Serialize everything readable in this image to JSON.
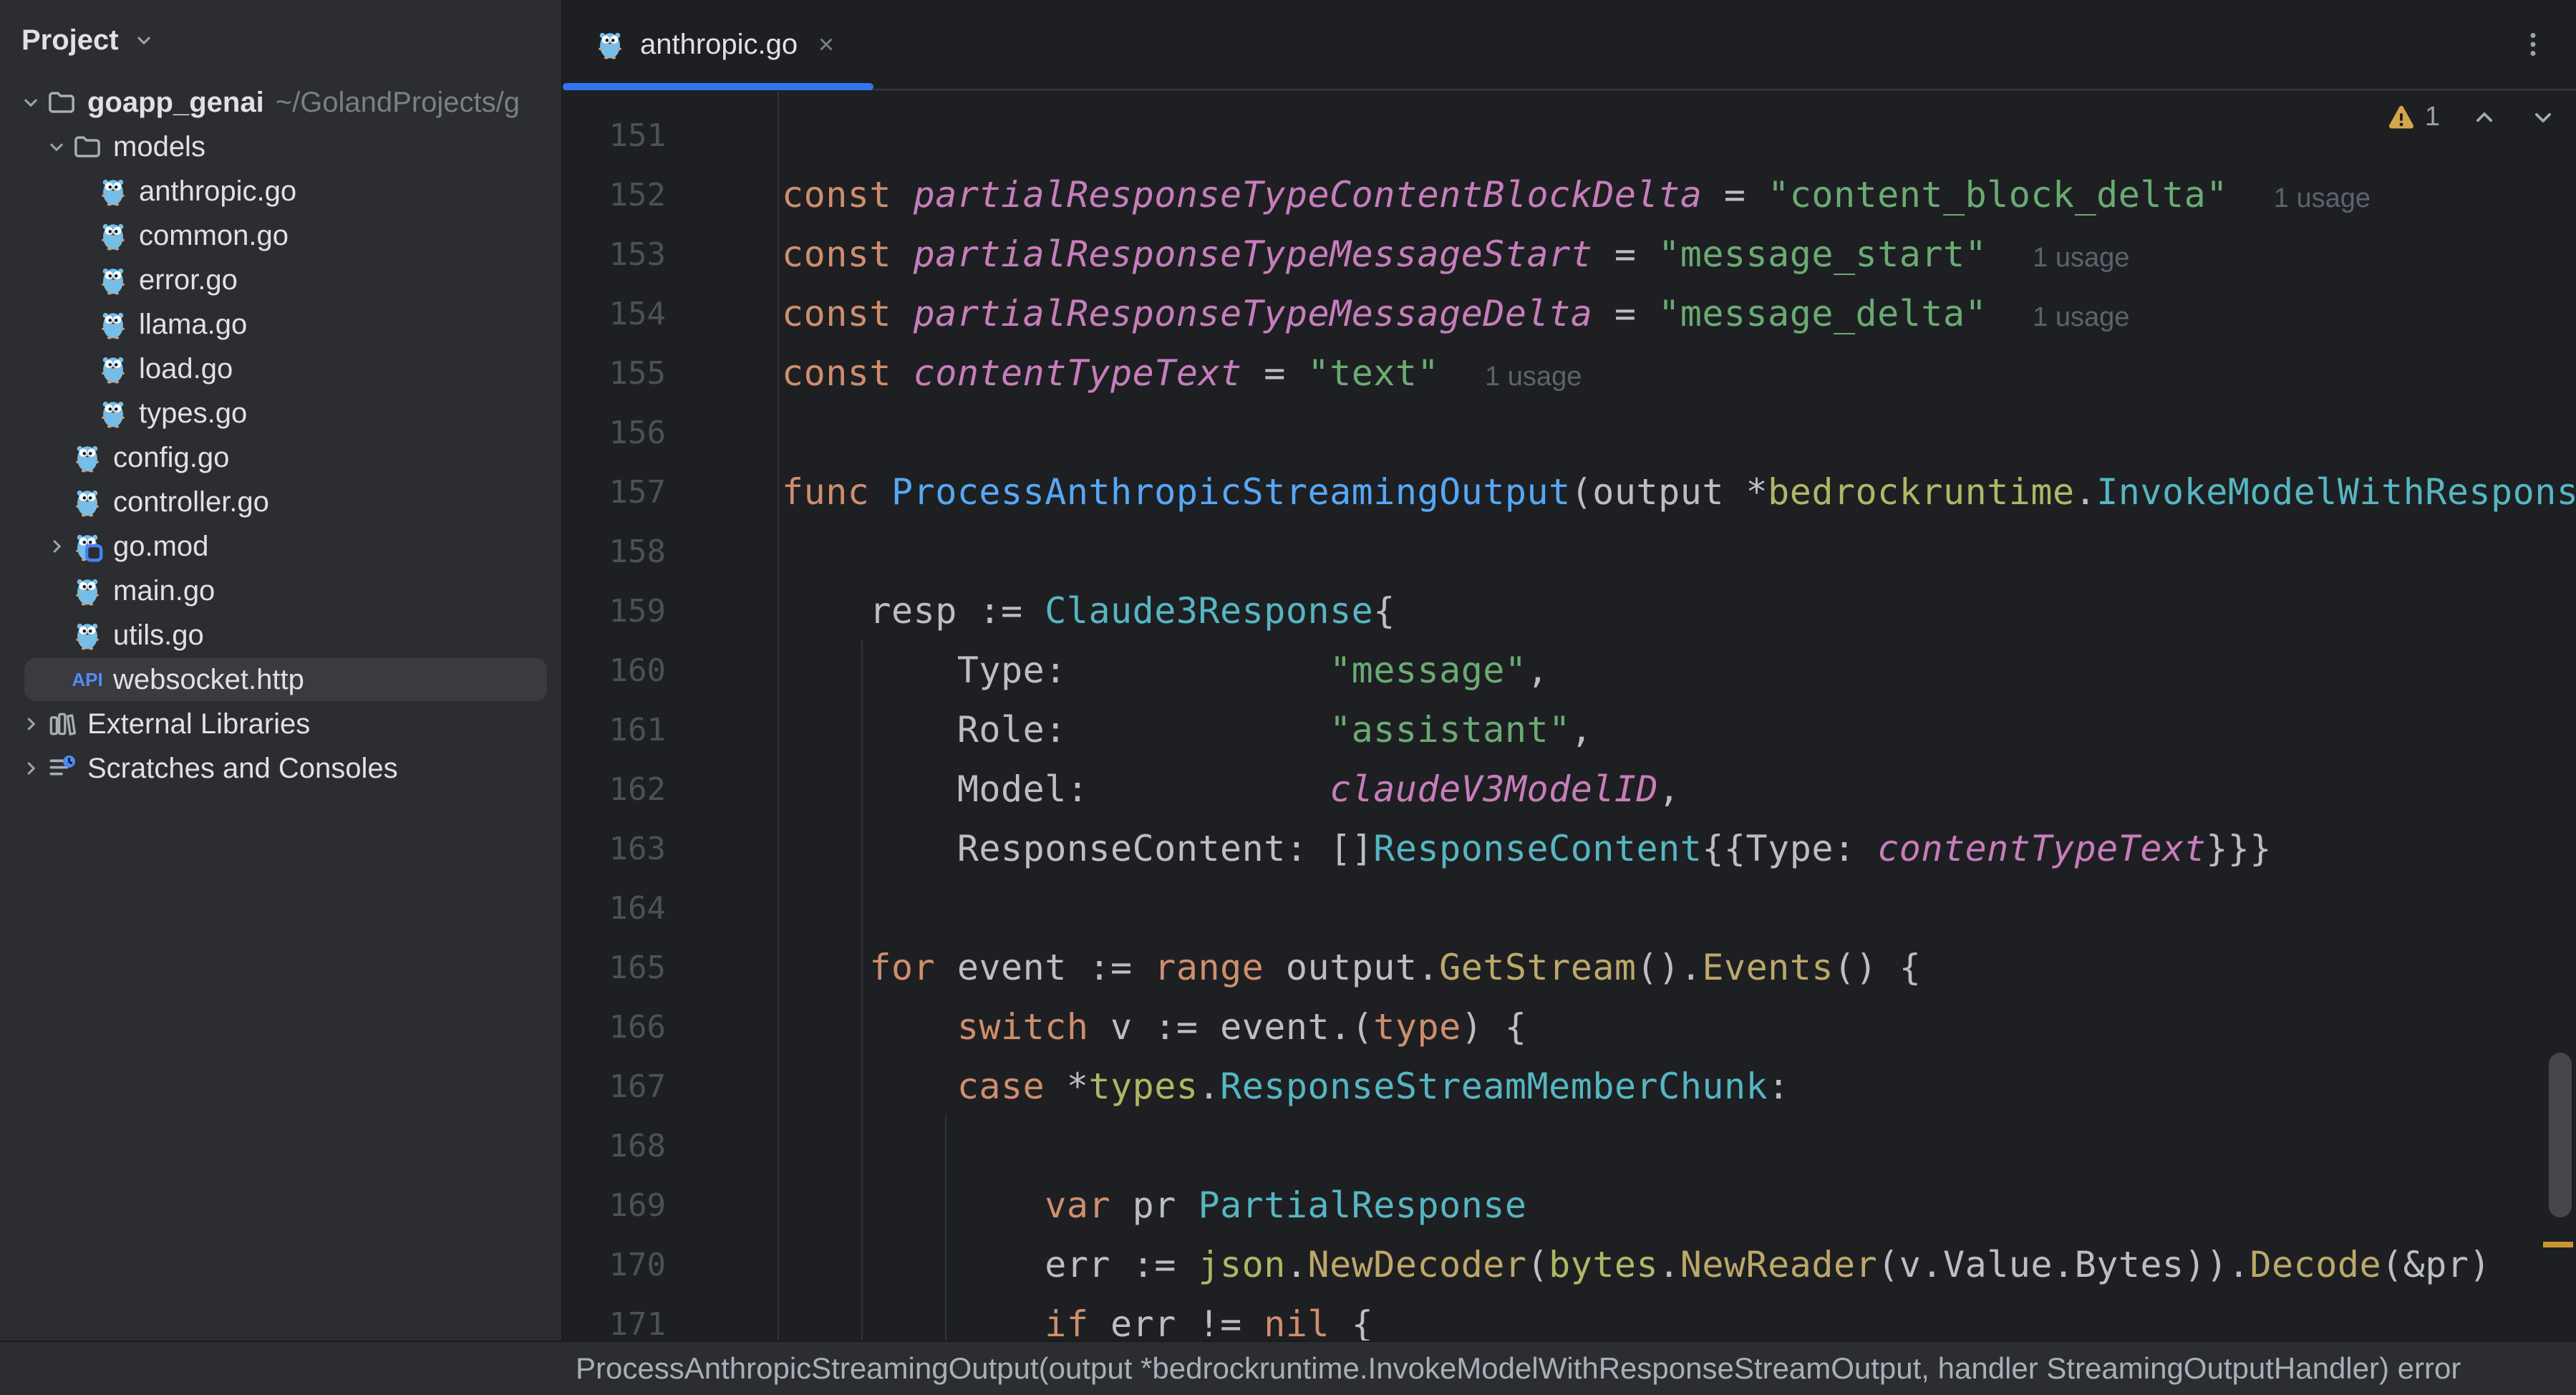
{
  "colors": {
    "accent": "#3574F0",
    "warning": "#D2A64A",
    "sidebar-bg": "#2B2D30",
    "editor-bg": "#1E1F22",
    "selection-bg": "#393B40",
    "syn-kw": "#CF8E6D",
    "syn-const": "#C77DBB",
    "syn-str": "#6AAB73",
    "syn-fn": "#56A8F5",
    "syn-type": "#56B6C2",
    "syn-pkg": "#B1B665",
    "syn-call": "#BDA869",
    "syn-txt": "#BCBEC4",
    "line-num": "#4B5059",
    "inlay": "#5D636D",
    "scroll-warn": "#C8962E"
  },
  "sidebar": {
    "header": {
      "title": "Project",
      "chevron_icon": "chevron-down"
    },
    "tree": [
      {
        "label": "goapp_genai",
        "path": "~/GolandProjects/g",
        "icon": "folder",
        "chevron": "down",
        "indent": 0,
        "bold": true
      },
      {
        "label": "models",
        "icon": "folder",
        "chevron": "down",
        "indent": 1
      },
      {
        "label": "anthropic.go",
        "icon": "go-gopher",
        "indent": 2
      },
      {
        "label": "common.go",
        "icon": "go-gopher",
        "indent": 2
      },
      {
        "label": "error.go",
        "icon": "go-gopher",
        "indent": 2
      },
      {
        "label": "llama.go",
        "icon": "go-gopher",
        "indent": 2
      },
      {
        "label": "load.go",
        "icon": "go-gopher",
        "indent": 2
      },
      {
        "label": "types.go",
        "icon": "go-gopher",
        "indent": 2
      },
      {
        "label": "config.go",
        "icon": "go-gopher",
        "indent": 1
      },
      {
        "label": "controller.go",
        "icon": "go-gopher",
        "indent": 1
      },
      {
        "label": "go.mod",
        "icon": "go-mod",
        "chevron": "right",
        "indent": 1
      },
      {
        "label": "main.go",
        "icon": "go-gopher",
        "indent": 1
      },
      {
        "label": "utils.go",
        "icon": "go-gopher",
        "indent": 1
      },
      {
        "label": "websocket.http",
        "icon": "api",
        "indent": 1,
        "selected": true
      },
      {
        "label": "External Libraries",
        "icon": "libraries",
        "chevron": "right",
        "indent": 0
      },
      {
        "label": "Scratches and Consoles",
        "icon": "scratches",
        "chevron": "right",
        "indent": 0
      }
    ]
  },
  "tabbar": {
    "tabs": [
      {
        "label": "anthropic.go",
        "icon": "go-gopher",
        "active": true
      }
    ],
    "kebab_icon": "kebab-menu"
  },
  "editor": {
    "inspection": {
      "warnings": "1"
    },
    "lines": [
      {
        "num": "151",
        "tokens": []
      },
      {
        "num": "152",
        "tokens": [
          {
            "t": "const ",
            "c": "kw"
          },
          {
            "t": "partialResponseTypeContentBlockDelta",
            "c": "const"
          },
          {
            "t": " = ",
            "c": "txt"
          },
          {
            "t": "\"content_block_delta\"",
            "c": "str"
          }
        ],
        "usage": "1 usage"
      },
      {
        "num": "153",
        "tokens": [
          {
            "t": "const ",
            "c": "kw"
          },
          {
            "t": "partialResponseTypeMessageStart",
            "c": "const"
          },
          {
            "t": " = ",
            "c": "txt"
          },
          {
            "t": "\"message_start\"",
            "c": "str"
          }
        ],
        "usage": "1 usage"
      },
      {
        "num": "154",
        "tokens": [
          {
            "t": "const ",
            "c": "kw"
          },
          {
            "t": "partialResponseTypeMessageDelta",
            "c": "const"
          },
          {
            "t": " = ",
            "c": "txt"
          },
          {
            "t": "\"message_delta\"",
            "c": "str"
          }
        ],
        "usage": "1 usage"
      },
      {
        "num": "155",
        "tokens": [
          {
            "t": "const ",
            "c": "kw"
          },
          {
            "t": "contentTypeText",
            "c": "const"
          },
          {
            "t": " = ",
            "c": "txt"
          },
          {
            "t": "\"text\"",
            "c": "str"
          }
        ],
        "usage": "1 usage"
      },
      {
        "num": "156",
        "tokens": []
      },
      {
        "num": "157",
        "tokens": [
          {
            "t": "func ",
            "c": "kw"
          },
          {
            "t": "ProcessAnthropicStreamingOutput",
            "c": "fn"
          },
          {
            "t": "(output *",
            "c": "txt"
          },
          {
            "t": "bedrockruntime",
            "c": "pkg"
          },
          {
            "t": ".",
            "c": "txt"
          },
          {
            "t": "InvokeModelWithResponse",
            "c": "type"
          }
        ]
      },
      {
        "num": "158",
        "tokens": []
      },
      {
        "num": "159",
        "tokens": [
          {
            "t": "    resp := ",
            "c": "txt"
          },
          {
            "t": "Claude3Response",
            "c": "type"
          },
          {
            "t": "{",
            "c": "txt"
          }
        ]
      },
      {
        "num": "160",
        "tokens": [
          {
            "t": "        Type:            ",
            "c": "txt"
          },
          {
            "t": "\"message\"",
            "c": "str"
          },
          {
            "t": ",",
            "c": "txt"
          }
        ]
      },
      {
        "num": "161",
        "tokens": [
          {
            "t": "        Role:            ",
            "c": "txt"
          },
          {
            "t": "\"assistant\"",
            "c": "str"
          },
          {
            "t": ",",
            "c": "txt"
          }
        ]
      },
      {
        "num": "162",
        "tokens": [
          {
            "t": "        Model:           ",
            "c": "txt"
          },
          {
            "t": "claudeV3ModelID",
            "c": "const"
          },
          {
            "t": ",",
            "c": "txt"
          }
        ]
      },
      {
        "num": "163",
        "tokens": [
          {
            "t": "        ResponseContent: []",
            "c": "txt"
          },
          {
            "t": "ResponseContent",
            "c": "type"
          },
          {
            "t": "{{Type: ",
            "c": "txt"
          },
          {
            "t": "contentTypeText",
            "c": "const"
          },
          {
            "t": "}}}",
            "c": "txt"
          }
        ]
      },
      {
        "num": "164",
        "tokens": []
      },
      {
        "num": "165",
        "tokens": [
          {
            "t": "    ",
            "c": "txt"
          },
          {
            "t": "for",
            "c": "kw"
          },
          {
            "t": " event := ",
            "c": "txt"
          },
          {
            "t": "range",
            "c": "kw"
          },
          {
            "t": " output.",
            "c": "txt"
          },
          {
            "t": "GetStream",
            "c": "call"
          },
          {
            "t": "().",
            "c": "txt"
          },
          {
            "t": "Events",
            "c": "call"
          },
          {
            "t": "() {",
            "c": "txt"
          }
        ]
      },
      {
        "num": "166",
        "tokens": [
          {
            "t": "        ",
            "c": "txt"
          },
          {
            "t": "switch",
            "c": "kw"
          },
          {
            "t": " v := event.(",
            "c": "txt"
          },
          {
            "t": "type",
            "c": "kw"
          },
          {
            "t": ") {",
            "c": "txt"
          }
        ]
      },
      {
        "num": "167",
        "tokens": [
          {
            "t": "        ",
            "c": "txt"
          },
          {
            "t": "case",
            "c": "kw"
          },
          {
            "t": " *",
            "c": "txt"
          },
          {
            "t": "types",
            "c": "pkg"
          },
          {
            "t": ".",
            "c": "txt"
          },
          {
            "t": "ResponseStreamMemberChunk",
            "c": "type"
          },
          {
            "t": ":",
            "c": "txt"
          }
        ]
      },
      {
        "num": "168",
        "tokens": []
      },
      {
        "num": "169",
        "tokens": [
          {
            "t": "            ",
            "c": "txt"
          },
          {
            "t": "var",
            "c": "kw"
          },
          {
            "t": " pr ",
            "c": "txt"
          },
          {
            "t": "PartialResponse",
            "c": "type"
          }
        ]
      },
      {
        "num": "170",
        "tokens": [
          {
            "t": "            err := ",
            "c": "txt"
          },
          {
            "t": "json",
            "c": "pkg"
          },
          {
            "t": ".",
            "c": "txt"
          },
          {
            "t": "NewDecoder",
            "c": "call"
          },
          {
            "t": "(",
            "c": "txt"
          },
          {
            "t": "bytes",
            "c": "pkg"
          },
          {
            "t": ".",
            "c": "txt"
          },
          {
            "t": "NewReader",
            "c": "call"
          },
          {
            "t": "(v.Value.Bytes)).",
            "c": "txt"
          },
          {
            "t": "Decode",
            "c": "call"
          },
          {
            "t": "(&pr)",
            "c": "txt"
          }
        ]
      },
      {
        "num": "171",
        "tokens": [
          {
            "t": "            ",
            "c": "txt"
          },
          {
            "t": "if",
            "c": "kw"
          },
          {
            "t": " err != ",
            "c": "txt"
          },
          {
            "t": "nil",
            "c": "kw"
          },
          {
            "t": " {",
            "c": "txt"
          }
        ]
      }
    ]
  },
  "statusbar": {
    "text": "ProcessAnthropicStreamingOutput(output *bedrockruntime.InvokeModelWithResponseStreamOutput, handler StreamingOutputHandler) error"
  }
}
